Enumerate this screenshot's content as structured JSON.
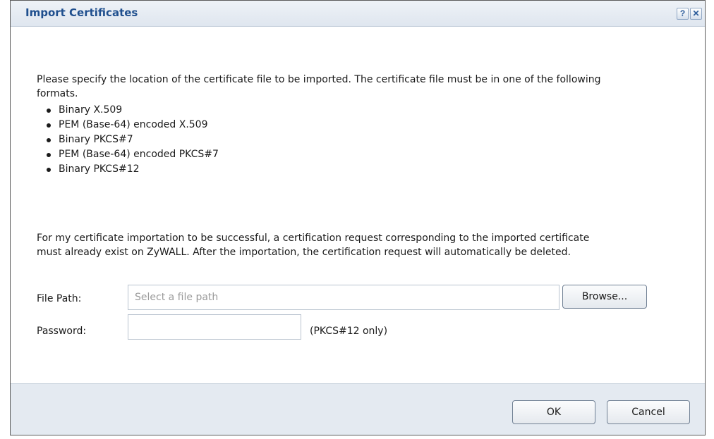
{
  "dialog": {
    "title": "Import Certificates",
    "help_symbol": "?",
    "close_symbol": "✕"
  },
  "content": {
    "intro": "Please specify the location of the certificate file to be imported. The certificate file must be in one of the following formats.",
    "formats": [
      "Binary X.509",
      "PEM (Base-64) encoded X.509",
      "Binary PKCS#7",
      "PEM (Base-64) encoded PKCS#7",
      "Binary PKCS#12"
    ],
    "note": "For my certificate importation to be successful, a certification request corresponding to the imported certificate must already exist on ZyWALL. After the importation, the certification request will automatically be deleted."
  },
  "form": {
    "file_path_label": "File Path:",
    "file_path_placeholder": "Select a file path",
    "file_path_value": "",
    "browse_label": "Browse...",
    "password_label": "Password:",
    "password_value": "",
    "password_hint": "(PKCS#12 only)"
  },
  "footer": {
    "ok_label": "OK",
    "cancel_label": "Cancel"
  },
  "colors": {
    "title": "#1f4f8e",
    "titlebar": "#dfe6ef",
    "footer": "#e4eaf1"
  }
}
